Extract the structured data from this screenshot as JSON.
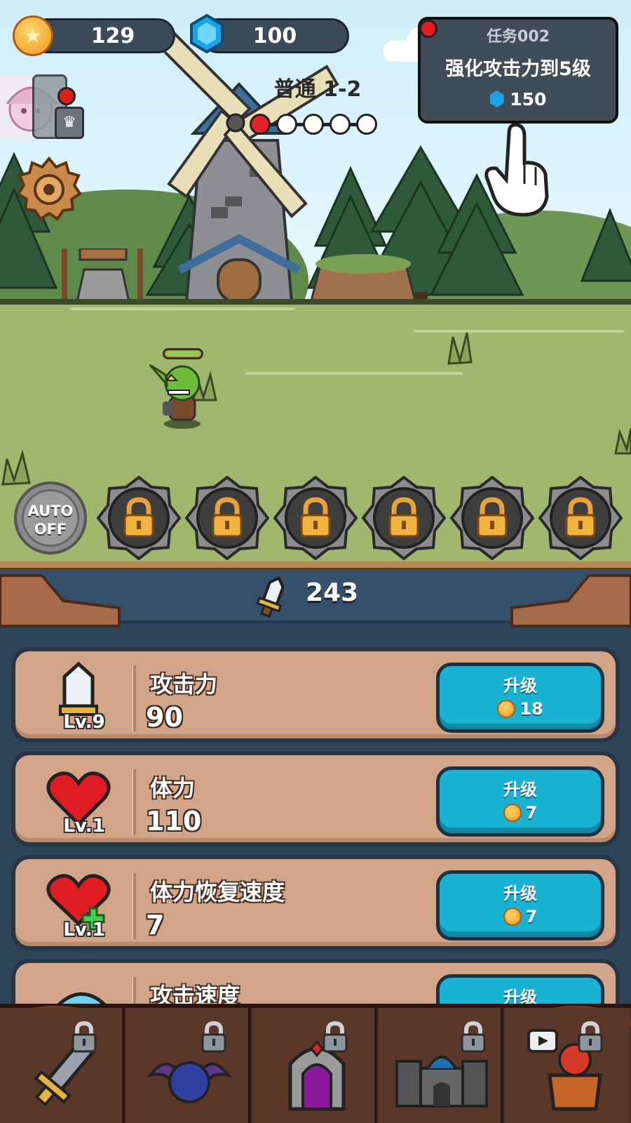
{
  "hud": {
    "coins": "129",
    "gems": "100"
  },
  "stage": {
    "label": "普通 1-2",
    "progress_total": 5,
    "progress_current": 1
  },
  "quest": {
    "title": "任务002",
    "description": "强化攻击力到5级",
    "reward": "150"
  },
  "skills": {
    "auto_label_1": "AUTO",
    "auto_label_2": "OFF",
    "locked_slots": 6
  },
  "power": {
    "value": "243"
  },
  "upgrades": [
    {
      "name": "攻击力",
      "level": "Lv.9",
      "value": "90",
      "button": "升级",
      "cost": "18",
      "icon": "sword-icon"
    },
    {
      "name": "体力",
      "level": "Lv.1",
      "value": "110",
      "button": "升级",
      "cost": "7",
      "icon": "heart-icon"
    },
    {
      "name": "体力恢复速度",
      "level": "Lv.1",
      "value": "7",
      "button": "升级",
      "cost": "7",
      "icon": "heart-plus-icon"
    },
    {
      "name": "攻击速度",
      "level": "",
      "value": "",
      "button": "升级",
      "cost": "",
      "icon": "attack-speed-icon"
    }
  ],
  "nav": [
    {
      "name": "weapon",
      "icon": "sword-icon",
      "locked": true
    },
    {
      "name": "pet",
      "icon": "bat-icon",
      "locked": true
    },
    {
      "name": "dungeon",
      "icon": "portal-icon",
      "locked": true
    },
    {
      "name": "castle",
      "icon": "castle-icon",
      "locked": true
    },
    {
      "name": "shop",
      "icon": "video-shop-icon",
      "locked": true
    }
  ],
  "colors": {
    "upgrade_button": "#17b2d4",
    "row_bg": "#d2a588",
    "panel_bg": "#2e4559",
    "nav_bg": "#4a2c22"
  }
}
